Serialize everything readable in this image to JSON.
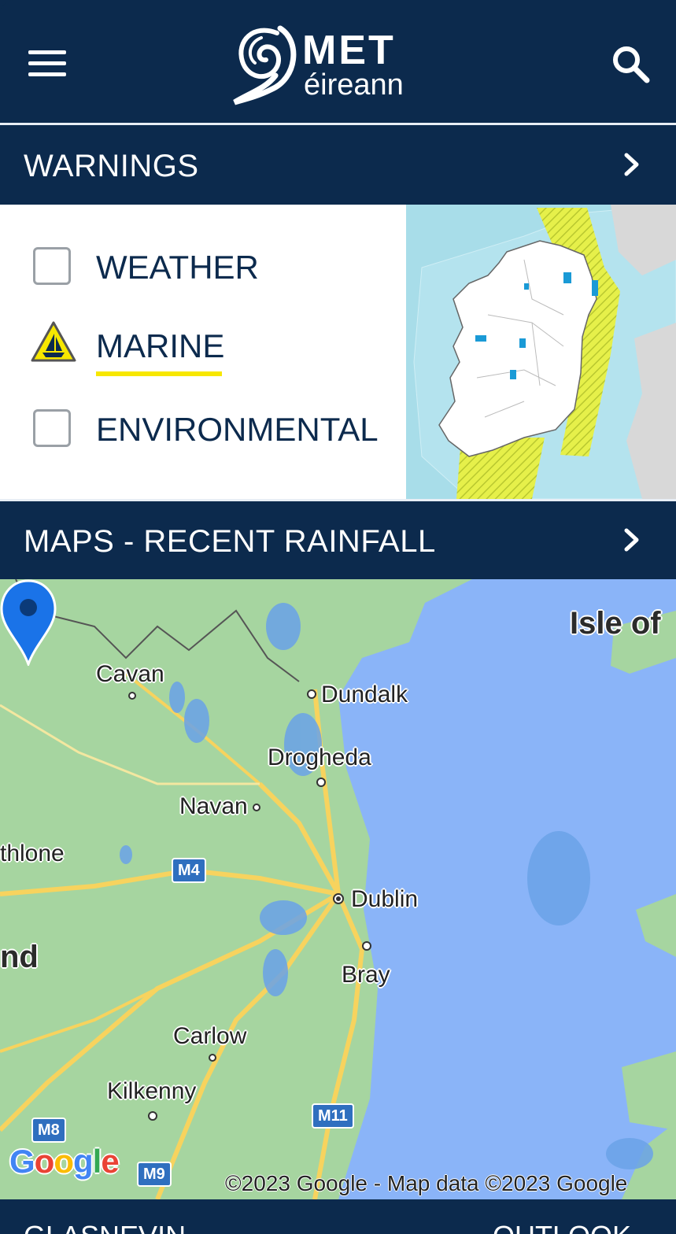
{
  "header": {
    "logo_top": "MET",
    "logo_bottom": "éireann",
    "menu_icon": "hamburger-menu-icon",
    "search_icon": "search-icon"
  },
  "warnings": {
    "title": "WARNINGS",
    "items": [
      {
        "label": "WEATHER",
        "state": "unchecked"
      },
      {
        "label": "MARINE",
        "state": "active-warning"
      },
      {
        "label": "ENVIRONMENTAL",
        "state": "unchecked"
      }
    ],
    "accent": "#f7e700"
  },
  "maps": {
    "title": "MAPS - RECENT RAINFALL",
    "places": [
      "Isle of",
      "Cavan",
      "Dundalk",
      "Drogheda",
      "Navan",
      "thlone",
      "Dublin",
      "nd",
      "Bray",
      "Carlow",
      "Kilkenny"
    ],
    "roads": [
      "M4",
      "M8",
      "M9",
      "M11"
    ],
    "google": "Google",
    "attribution": "©2023 Google - Map data ©2023 Google"
  },
  "bottom": {
    "left": "GLASNEVIN",
    "right": "OUTLOOK"
  },
  "colors": {
    "brand_navy": "#0c2a4d",
    "sea": "#8ab4f8",
    "land": "#a6d5a0"
  }
}
